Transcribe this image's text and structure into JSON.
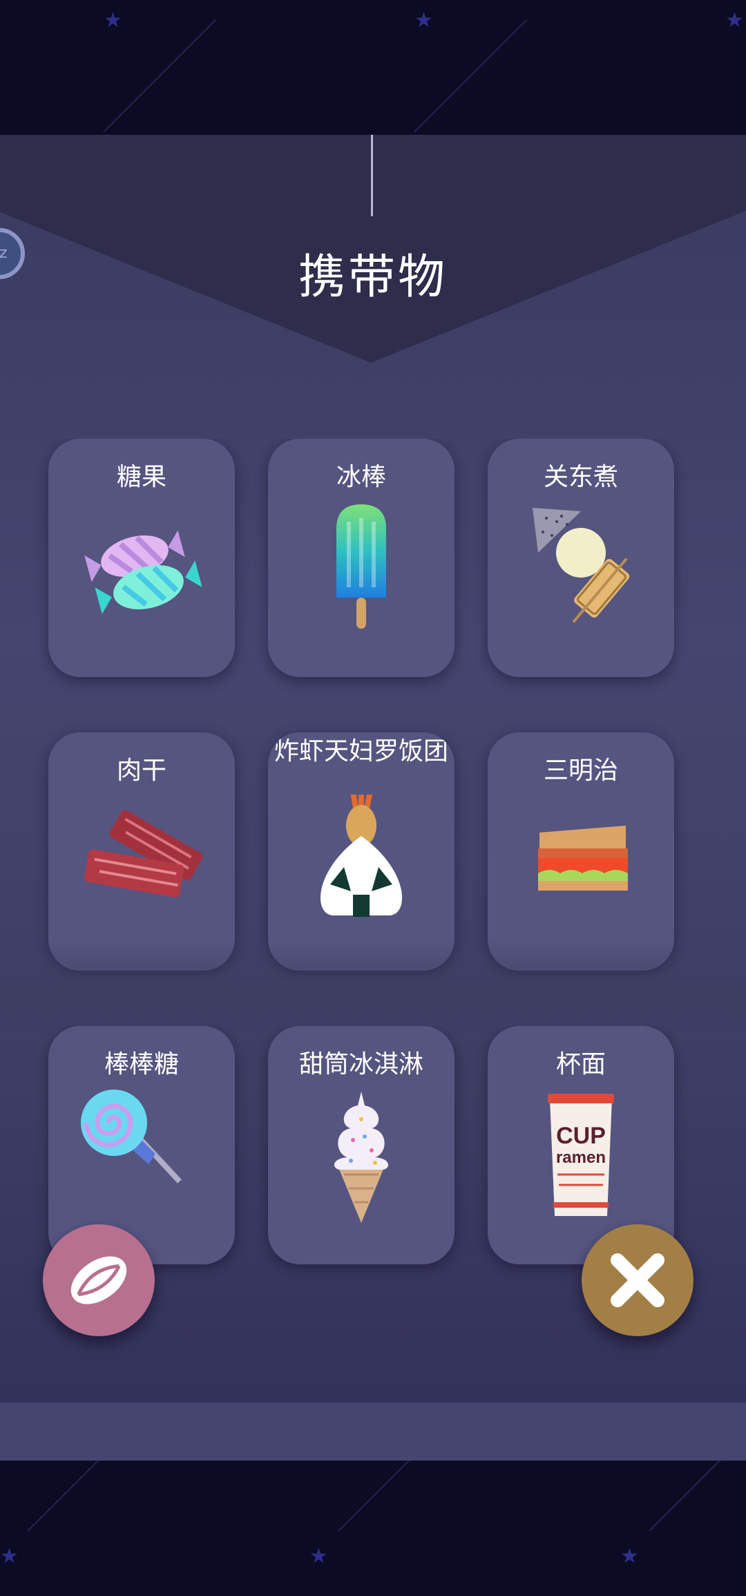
{
  "panel": {
    "title": "携带物",
    "badge_text": "zz"
  },
  "items": [
    {
      "label": "糖果",
      "icon": "candy-icon"
    },
    {
      "label": "冰棒",
      "icon": "popsicle-icon"
    },
    {
      "label": "关东煮",
      "icon": "oden-icon"
    },
    {
      "label": "肉干",
      "icon": "jerky-icon"
    },
    {
      "label": "炸虾天妇罗饭团",
      "icon": "tempura-onigiri-icon"
    },
    {
      "label": "三明治",
      "icon": "sandwich-icon"
    },
    {
      "label": "棒棒糖",
      "icon": "lollipop-icon"
    },
    {
      "label": "甜筒冰淇淋",
      "icon": "ice-cream-cone-icon"
    },
    {
      "label": "杯面",
      "icon": "cup-noodle-icon"
    }
  ],
  "cup_noodle_text": {
    "line1": "CUP",
    "line2": "ramen"
  },
  "buttons": {
    "left_icon": "seed-icon",
    "right_icon": "close-icon"
  },
  "colors": {
    "background": "#0c0b24",
    "panel": "#45456f",
    "card": "#555580",
    "left_button": "#b8708f",
    "right_button": "#a27f45"
  }
}
